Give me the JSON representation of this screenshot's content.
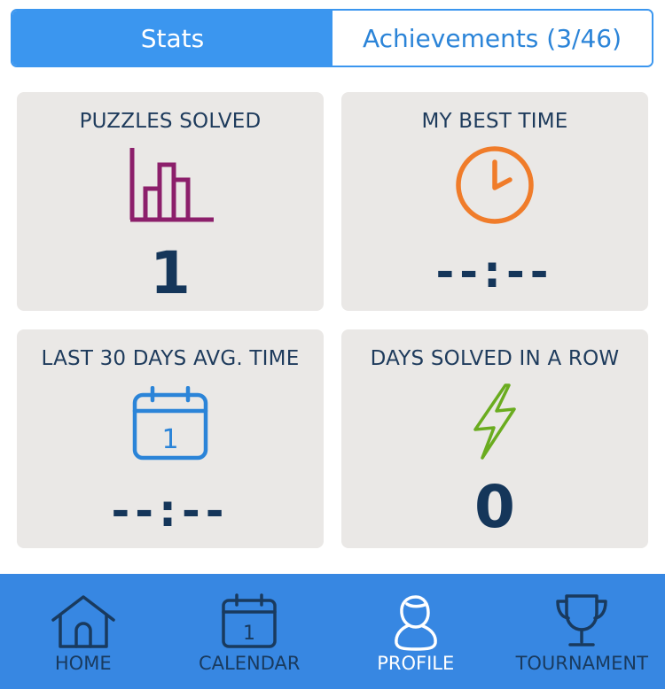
{
  "tabs": {
    "stats_label": "Stats",
    "achievements_label": "Achievements (3/46)"
  },
  "cards": [
    {
      "title": "PUZZLES SOLVED",
      "value": "1",
      "icon": "bar-chart-icon"
    },
    {
      "title": "MY BEST TIME",
      "value": "--:--",
      "icon": "clock-icon"
    },
    {
      "title": "LAST 30 DAYS AVG. TIME",
      "value": "--:--",
      "icon": "calendar-icon"
    },
    {
      "title": "DAYS SOLVED IN A ROW",
      "value": "0",
      "icon": "lightning-icon"
    }
  ],
  "calendar_icon_day": "1",
  "nav": [
    {
      "label": "HOME",
      "icon": "home-icon"
    },
    {
      "label": "CALENDAR",
      "icon": "calendar-icon"
    },
    {
      "label": "PROFILE",
      "icon": "profile-icon",
      "active": true
    },
    {
      "label": "TOURNAMENT",
      "icon": "trophy-icon"
    }
  ],
  "colors": {
    "accent": "#3b96ef",
    "nav_background": "#3787e2",
    "card_background": "#eae8e6",
    "value_text": "#15365a",
    "bar_chart": "#8c1f6b",
    "clock": "#f07c2a",
    "calendar": "#2b84d8",
    "lightning": "#6aac1f"
  }
}
